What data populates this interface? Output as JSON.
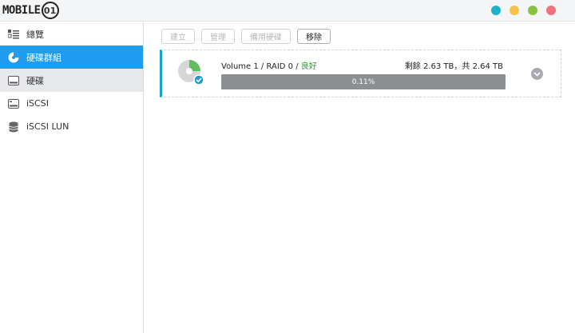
{
  "logo": {
    "text": "MOBILE",
    "mark": "01"
  },
  "window_controls": [
    {
      "name": "teal-window-dot",
      "color": "#1fb2c6"
    },
    {
      "name": "yellow-window-dot",
      "color": "#f5c24a"
    },
    {
      "name": "green-window-dot",
      "color": "#88c340"
    },
    {
      "name": "red-window-dot",
      "color": "#f0727d"
    }
  ],
  "sidebar": {
    "items": [
      {
        "label": "總覽",
        "icon": "list-icon"
      },
      {
        "label": "硬碟群組",
        "icon": "storage-pool-icon",
        "active": true
      },
      {
        "label": "硬碟",
        "icon": "hard-drive-icon"
      },
      {
        "label": "iSCSI",
        "icon": "iscsi-icon"
      },
      {
        "label": "iSCSI LUN",
        "icon": "database-icon"
      }
    ]
  },
  "toolbar": {
    "create_label": "建立",
    "manage_label": "管理",
    "spare_label": "備用硬碟",
    "remove_label": "移除"
  },
  "volume": {
    "name": "Volume 1",
    "sep1": " / ",
    "raid": "RAID 0",
    "sep2": " / ",
    "status": "良好",
    "free": "剩餘 2.63 TB",
    "total": "，共 2.64 TB",
    "usage_percent": 0.11,
    "usage_label": "0.11%"
  },
  "colors": {
    "accent": "#1f9bf0",
    "status_ok": "#3a8f3a",
    "card_border": "#17a3c4"
  }
}
